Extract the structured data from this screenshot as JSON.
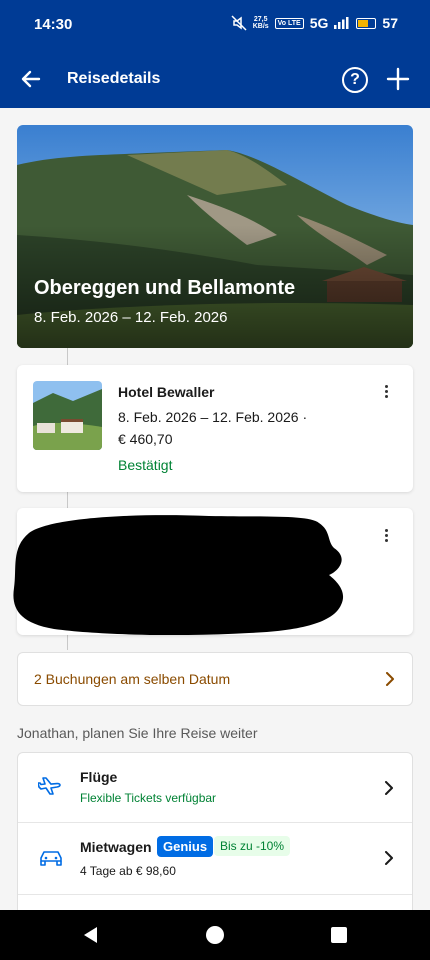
{
  "status_bar": {
    "time": "14:30",
    "speed_value": "27,5",
    "speed_unit": "KB/s",
    "volte": "Vo LTE",
    "network": "5G",
    "battery": "57",
    "icons": [
      "mute-icon",
      "signal-icon",
      "battery-icon"
    ]
  },
  "app_bar": {
    "title": "Reisedetails",
    "help_glyph": "?",
    "icons": [
      "back-arrow-icon",
      "help-icon",
      "plus-icon"
    ]
  },
  "trip": {
    "title": "Obereggen und Bellamonte",
    "dates": "8. Feb. 2026 – 12. Feb. 2026"
  },
  "hotel": {
    "name": "Hotel Bewaller",
    "dates": "8. Feb. 2026 – 12. Feb. 2026 ·",
    "price": "€ 460,70",
    "status": "Bestätigt"
  },
  "bookings_banner": {
    "label": "2 Buchungen am selben Datum"
  },
  "plan": {
    "heading": "Jonathan, planen Sie Ihre Reise weiter",
    "items": [
      {
        "title": "Flüge",
        "subtitle": "Flexible Tickets verfügbar",
        "icon": "plane-icon"
      },
      {
        "title": "Mietwagen",
        "badge": "Genius",
        "discount": "Bis zu -10%",
        "subtitle": "4 Tage ab € 98,60",
        "icon": "car-icon"
      }
    ]
  },
  "colors": {
    "brand_blue": "#003b95",
    "genius_blue": "#006ce4",
    "success_green": "#008234",
    "warning_brown": "#8a4b00"
  }
}
